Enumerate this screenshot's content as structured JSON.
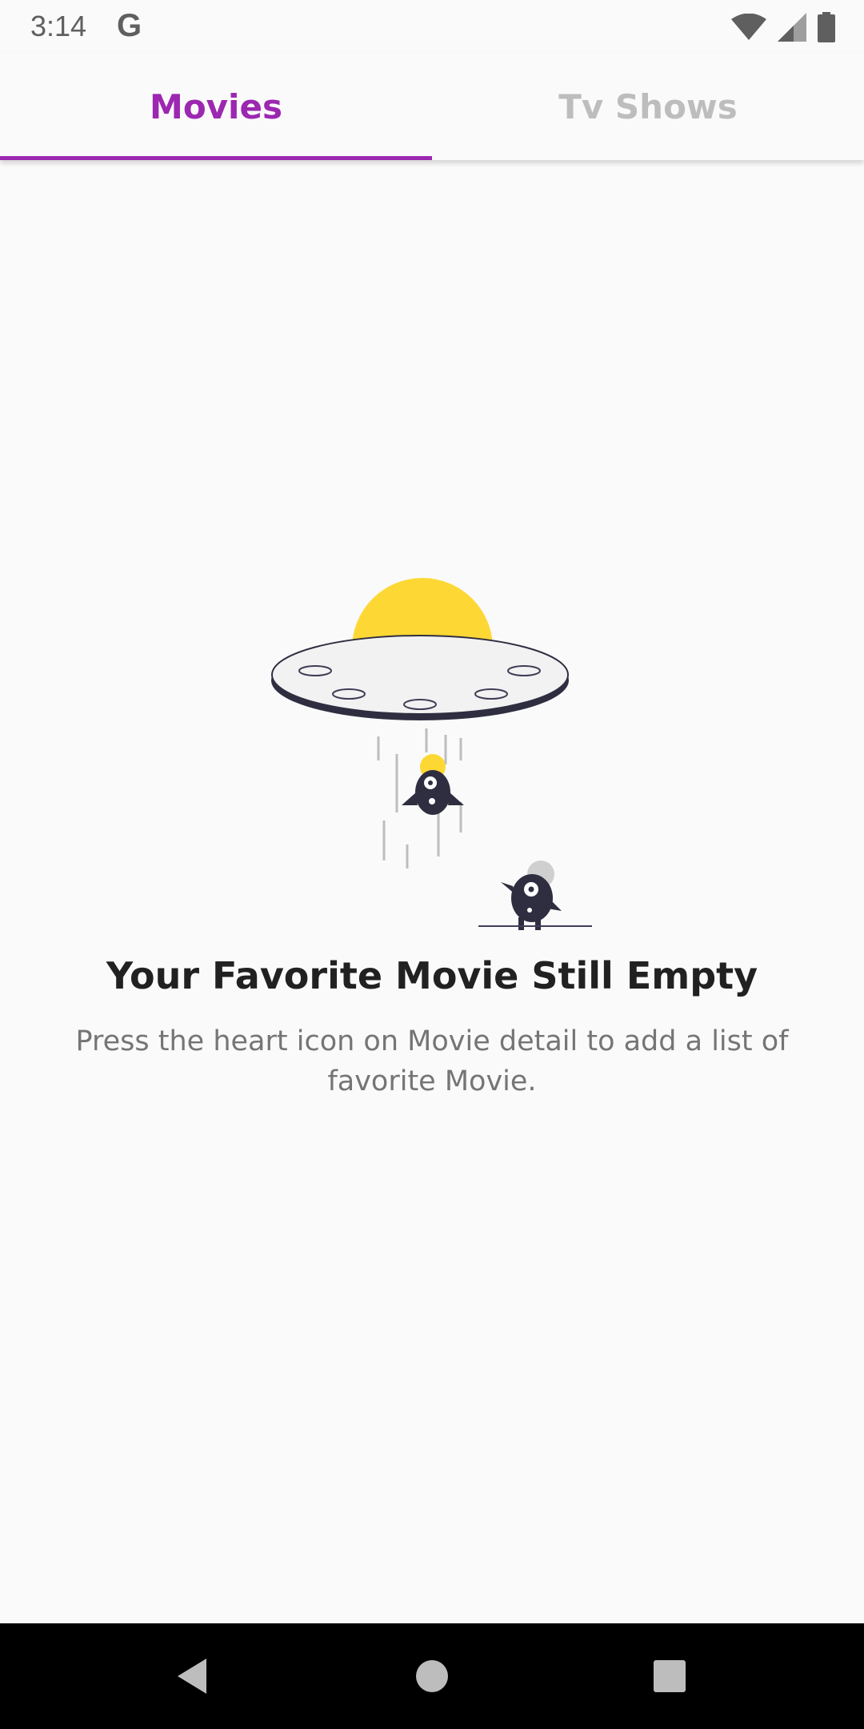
{
  "status_bar": {
    "time": "3:14",
    "google_glyph": "G",
    "icons": [
      "wifi-icon",
      "signal-icon",
      "battery-icon"
    ]
  },
  "tabs": [
    {
      "label": "Movies",
      "active": true
    },
    {
      "label": "Tv Shows",
      "active": false
    }
  ],
  "empty_state": {
    "illustration": "ufo-abduction-illustration",
    "title": "Your Favorite Movie Still Empty",
    "description": "Press the heart icon on Movie detail to add a list of favorite Movie."
  },
  "navigation_bar": {
    "buttons": [
      "back-icon",
      "home-icon",
      "recents-icon"
    ]
  },
  "colors": {
    "accent": "#9c27b0",
    "inactive_tab": "#bdbdbd",
    "ufo_dome": "#fdd835",
    "ink": "#2f2e41"
  }
}
